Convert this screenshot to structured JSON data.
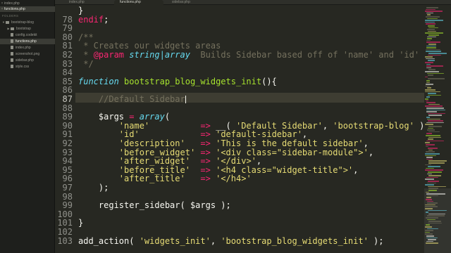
{
  "tabs": [
    {
      "label": "index.php",
      "active": false
    },
    {
      "label": "functions.php",
      "active": true
    },
    {
      "label": "sidebar.php",
      "active": false
    }
  ],
  "sidebar": {
    "open_files_label": "OPEN FILES",
    "open_files": [
      {
        "label": "index.php",
        "selected": false
      },
      {
        "label": "functions.php",
        "selected": true
      }
    ],
    "folders_label": "FOLDERS",
    "tree": [
      {
        "label": "bootstrap-blog",
        "type": "folder",
        "depth": 0,
        "selected": false
      },
      {
        "label": "bootstrap",
        "type": "folder",
        "depth": 1,
        "selected": false
      },
      {
        "label": "config.codekit",
        "type": "file",
        "depth": 1,
        "selected": false
      },
      {
        "label": "functions.php",
        "type": "file",
        "depth": 1,
        "selected": true
      },
      {
        "label": "index.php",
        "type": "file",
        "depth": 1,
        "selected": false
      },
      {
        "label": "screenshot.png",
        "type": "file",
        "depth": 1,
        "selected": false
      },
      {
        "label": "sidebar.php",
        "type": "file",
        "depth": 1,
        "selected": false
      },
      {
        "label": "style.css",
        "type": "file",
        "depth": 1,
        "selected": false
      }
    ]
  },
  "editor": {
    "current_line": "87",
    "lines": [
      {
        "n": "",
        "tokens": [
          {
            "t": "}",
            "c": ""
          }
        ]
      },
      {
        "n": "78",
        "tokens": [
          {
            "t": "endif",
            "c": "kw"
          },
          {
            "t": ";",
            "c": ""
          }
        ]
      },
      {
        "n": "79",
        "tokens": []
      },
      {
        "n": "80",
        "tokens": [
          {
            "t": "/**",
            "c": "cm"
          }
        ]
      },
      {
        "n": "81",
        "tokens": [
          {
            "t": " * Creates our widgets areas",
            "c": "cm"
          }
        ]
      },
      {
        "n": "82",
        "tokens": [
          {
            "t": " * ",
            "c": "cm"
          },
          {
            "t": "@param",
            "c": "at"
          },
          {
            "t": " ",
            "c": "cm"
          },
          {
            "t": "string|array",
            "c": "ty"
          },
          {
            "t": "  Builds Sidebar based off of 'name' and 'id' values.",
            "c": "cm"
          }
        ]
      },
      {
        "n": "83",
        "tokens": [
          {
            "t": " */",
            "c": "cm"
          }
        ]
      },
      {
        "n": "84",
        "tokens": []
      },
      {
        "n": "85",
        "tokens": [
          {
            "t": "function",
            "c": "fi"
          },
          {
            "t": " ",
            "c": ""
          },
          {
            "t": "bootstrap_blog_widgets_init",
            "c": "fn"
          },
          {
            "t": "(){",
            "c": ""
          }
        ]
      },
      {
        "n": "86",
        "tokens": []
      },
      {
        "n": "87",
        "tokens": [
          {
            "t": "    //Default Sidebar",
            "c": "cm"
          }
        ],
        "cursor": true
      },
      {
        "n": "88",
        "tokens": []
      },
      {
        "n": "89",
        "tokens": [
          {
            "t": "    $args ",
            "c": ""
          },
          {
            "t": "=",
            "c": "kw"
          },
          {
            "t": " ",
            "c": ""
          },
          {
            "t": "array",
            "c": "fi"
          },
          {
            "t": "(",
            "c": ""
          }
        ]
      },
      {
        "n": "90",
        "tokens": [
          {
            "t": "        ",
            "c": ""
          },
          {
            "t": "'name'",
            "c": "st"
          },
          {
            "t": "          ",
            "c": ""
          },
          {
            "t": "=>",
            "c": "kw"
          },
          {
            "t": " __( ",
            "c": ""
          },
          {
            "t": "'Default Sidebar'",
            "c": "st"
          },
          {
            "t": ", ",
            "c": ""
          },
          {
            "t": "'bootstrap-blog'",
            "c": "st"
          },
          {
            "t": " ),",
            "c": ""
          }
        ]
      },
      {
        "n": "91",
        "tokens": [
          {
            "t": "        ",
            "c": ""
          },
          {
            "t": "'id'",
            "c": "st"
          },
          {
            "t": "            ",
            "c": ""
          },
          {
            "t": "=>",
            "c": "kw"
          },
          {
            "t": " ",
            "c": ""
          },
          {
            "t": "'default-sidebar'",
            "c": "st"
          },
          {
            "t": ",",
            "c": ""
          }
        ]
      },
      {
        "n": "92",
        "tokens": [
          {
            "t": "        ",
            "c": ""
          },
          {
            "t": "'description'",
            "c": "st"
          },
          {
            "t": "   ",
            "c": ""
          },
          {
            "t": "=>",
            "c": "kw"
          },
          {
            "t": " ",
            "c": ""
          },
          {
            "t": "'This is the default sidebar'",
            "c": "st"
          },
          {
            "t": ",",
            "c": ""
          }
        ]
      },
      {
        "n": "93",
        "tokens": [
          {
            "t": "        ",
            "c": ""
          },
          {
            "t": "'before_widget'",
            "c": "st"
          },
          {
            "t": " ",
            "c": ""
          },
          {
            "t": "=>",
            "c": "kw"
          },
          {
            "t": " ",
            "c": ""
          },
          {
            "t": "'<div class=\"sidebar-module\">'",
            "c": "st"
          },
          {
            "t": ",",
            "c": ""
          }
        ]
      },
      {
        "n": "94",
        "tokens": [
          {
            "t": "        ",
            "c": ""
          },
          {
            "t": "'after_widget'",
            "c": "st"
          },
          {
            "t": "  ",
            "c": ""
          },
          {
            "t": "=>",
            "c": "kw"
          },
          {
            "t": " ",
            "c": ""
          },
          {
            "t": "'</div>'",
            "c": "st"
          },
          {
            "t": ",",
            "c": ""
          }
        ]
      },
      {
        "n": "95",
        "tokens": [
          {
            "t": "        ",
            "c": ""
          },
          {
            "t": "'before_title'",
            "c": "st"
          },
          {
            "t": "  ",
            "c": ""
          },
          {
            "t": "=>",
            "c": "kw"
          },
          {
            "t": " ",
            "c": ""
          },
          {
            "t": "'<h4 class=\"widget-title\">'",
            "c": "st"
          },
          {
            "t": ",",
            "c": ""
          }
        ]
      },
      {
        "n": "96",
        "tokens": [
          {
            "t": "        ",
            "c": ""
          },
          {
            "t": "'after_title'",
            "c": "st"
          },
          {
            "t": "   ",
            "c": ""
          },
          {
            "t": "=>",
            "c": "kw"
          },
          {
            "t": " ",
            "c": ""
          },
          {
            "t": "'</h4>'",
            "c": "st"
          }
        ]
      },
      {
        "n": "97",
        "tokens": [
          {
            "t": "    );",
            "c": ""
          }
        ]
      },
      {
        "n": "98",
        "tokens": []
      },
      {
        "n": "99",
        "tokens": [
          {
            "t": "    register_sidebar( $args );",
            "c": ""
          }
        ]
      },
      {
        "n": "100",
        "tokens": []
      },
      {
        "n": "101",
        "tokens": [
          {
            "t": "}",
            "c": ""
          }
        ]
      },
      {
        "n": "102",
        "tokens": []
      },
      {
        "n": "103",
        "tokens": [
          {
            "t": "add_action( ",
            "c": ""
          },
          {
            "t": "'widgets_init'",
            "c": "st"
          },
          {
            "t": ", ",
            "c": ""
          },
          {
            "t": "'bootstrap_blog_widgets_init'",
            "c": "st"
          },
          {
            "t": " );",
            "c": ""
          }
        ]
      }
    ]
  },
  "colors": {
    "background": "#272822",
    "keyword": "#f92672",
    "function_name": "#a6e22e",
    "string": "#e6db74",
    "comment": "#75715e",
    "storage": "#66d9ef"
  }
}
